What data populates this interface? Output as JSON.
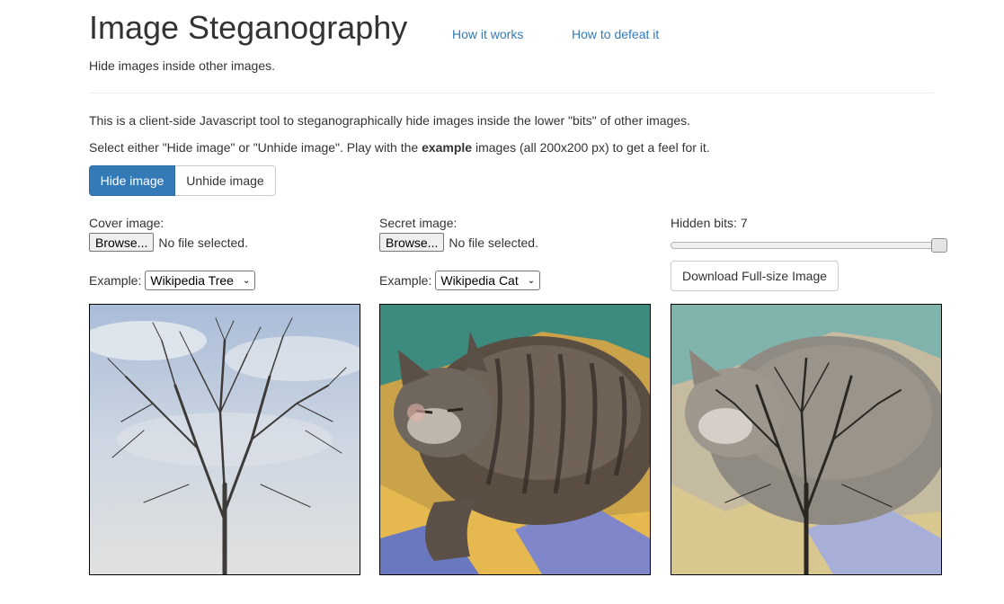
{
  "header": {
    "title": "Image Steganography",
    "nav": [
      "How it works",
      "How to defeat it"
    ],
    "subtitle": "Hide images inside other images."
  },
  "intro": {
    "line1": "This is a client-side Javascript tool to steganographically hide images inside the lower \"bits\" of other images.",
    "line2_before": "Select either \"Hide image\" or \"Unhide image\". Play with the ",
    "line2_bold": "example",
    "line2_after": " images (all 200x200 px) to get a feel for it."
  },
  "mode": {
    "hide_label": "Hide image",
    "unhide_label": "Unhide image",
    "active": "hide"
  },
  "cover": {
    "label": "Cover image:",
    "browse_label": "Browse...",
    "file_status": "No file selected.",
    "example_label": "Example:",
    "example_selected": "Wikipedia Tree"
  },
  "secret": {
    "label": "Secret image:",
    "browse_label": "Browse...",
    "file_status": "No file selected.",
    "example_label": "Example:",
    "example_selected": "Wikipedia Cat"
  },
  "output": {
    "hidden_bits_label": "Hidden bits: 7",
    "hidden_bits": 7,
    "hidden_bits_max": 7,
    "download_label": "Download Full-size Image"
  },
  "colors": {
    "primary": "#337ab7",
    "link": "#337ab7"
  }
}
